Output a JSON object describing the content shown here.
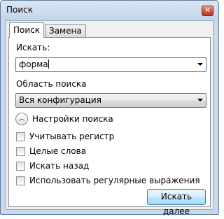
{
  "window": {
    "title": "Поиск",
    "close_glyph": "✕"
  },
  "tabs": [
    {
      "label": "Поиск",
      "active": true
    },
    {
      "label": "Замена",
      "active": false
    }
  ],
  "find": {
    "label": "Искать:",
    "value": "форма"
  },
  "area": {
    "label": "Область поиска",
    "selected": "Вся конфигурация"
  },
  "options": {
    "expander_label": "Настройки поиска",
    "expander_glyph": "︿",
    "checkboxes": [
      {
        "label": "Учитывать регистр",
        "checked": false
      },
      {
        "label": "Целые слова",
        "checked": false
      },
      {
        "label": "Искать назад",
        "checked": false
      },
      {
        "label": "Использовать регулярные выражения",
        "checked": false
      }
    ]
  },
  "actions": {
    "find_next_label": "Искать далее"
  },
  "colors": {
    "window_frame": "#c9d8ea",
    "accent_border": "#3c7fb1",
    "close_red": "#c8503c"
  }
}
